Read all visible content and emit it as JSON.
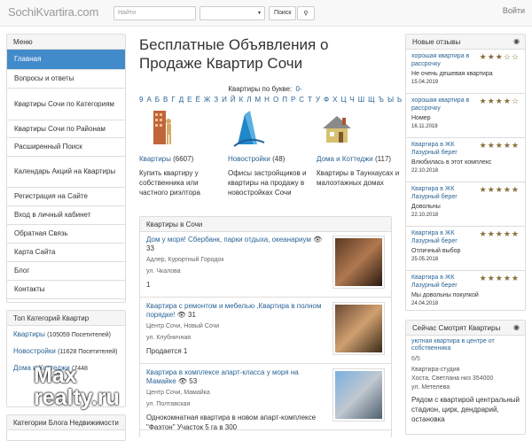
{
  "header": {
    "logo": "SochiKvartira",
    "logo_tld": ".com",
    "search_placeholder": "Найти",
    "search_button": "Поиск",
    "login": "Войти"
  },
  "menu": {
    "title": "Меню",
    "items": [
      "Главная",
      "Вопросы и ответы",
      "Квартиры Сочи по Категориям",
      "Квартиры Сочи по Районам",
      "Расширенный Поиск",
      "Календарь Акций на Квартиры",
      "Регистрация на Сайте",
      "Вход в личный кабинет",
      "Обратная Связь",
      "Карта Сайта",
      "Блог",
      "Контакты"
    ]
  },
  "top_categories": {
    "title": "Топ Категорий Квартир",
    "items": [
      {
        "name": "Квартиры",
        "count": "(105059 Посетителей)"
      },
      {
        "name": "Новостройки",
        "count": "(11628 Посетителей)"
      },
      {
        "name": "Дома и Коттеджи",
        "count": "(7448"
      }
    ]
  },
  "blog_categories": {
    "title": "Категории Блога Недвижимости"
  },
  "main": {
    "title": "Бесплатные Объявления о Продаже Квартир Сочи",
    "letters_label": "Квартиры по букве:",
    "letters": [
      "0-9",
      "А",
      "Б",
      "В",
      "Г",
      "Д",
      "Е",
      "Ё",
      "Ж",
      "З",
      "И",
      "Й",
      "К",
      "Л",
      "М",
      "Н",
      "О",
      "П",
      "Р",
      "С",
      "Т",
      "У",
      "Ф",
      "Х",
      "Ц",
      "Ч",
      "Ш",
      "Щ",
      "Ъ",
      "Ы",
      "Ь",
      "Э",
      "Ю",
      "Я"
    ],
    "cats": [
      {
        "name": "Квартиры",
        "count": "(6607)",
        "desc": "Купить квартиру у собственника или частного риэлтора"
      },
      {
        "name": "Новостройки",
        "count": "(48)",
        "desc": "Офисы застройщиков и квартиры на продажу в новостройках Сочи"
      },
      {
        "name": "Дома и Коттеджи",
        "count": "(117)",
        "desc": "Квартиры в Таунхаусах и малоэтажных домах"
      }
    ],
    "listings_title": "Квартиры в Сочи",
    "listings": [
      {
        "title": "Дом у моря! Сбербанк, парки отдыха, океанариум",
        "views": "33",
        "loc": "Адлер, Курортный Городок",
        "street": "ул. Чкалова",
        "text": "1"
      },
      {
        "title": "Квартира с ремонтом и мебелью ,Квартира в полном порядке!",
        "views": "31",
        "loc": "Центр Сочи, Новый Сочи",
        "street": "ул. Клубничная",
        "text": "Продается 1"
      },
      {
        "title": "Квартира в комплексе апарт-класса у моря на Мамайке",
        "views": "53",
        "loc": "Центр Сочи, Мамайка",
        "street": "ул. Полтавская",
        "text": "Однокомнатная квартира в новом апарт-комплексе \"Фаэтон\" Участок 5 га в 300"
      }
    ]
  },
  "reviews": {
    "title": "Новые отзывы",
    "items": [
      {
        "title": "хорошая квартира в рассрочку",
        "stars": 3,
        "comment": "Не очень дешевая квартира",
        "date": "15.04.2019"
      },
      {
        "title": "хорошая квартира в рассрочку",
        "stars": 4,
        "comment": "Номер",
        "date": "16.11.2018"
      },
      {
        "title": "Квартира в ЖК Лазурный берег",
        "stars": 5,
        "comment": "Влюбилась в этот комплекс",
        "date": "22.10.2018"
      },
      {
        "title": "Квартира в ЖК Лазурный берег",
        "stars": 5,
        "comment": "Довольны",
        "date": "22.10.2018"
      },
      {
        "title": "Квартира в ЖК Лазурный берег",
        "stars": 5,
        "comment": "Отличный выбор",
        "date": "25.05.2018"
      },
      {
        "title": "Квартира в ЖК Лазурный берег",
        "stars": 5,
        "comment": "Мы довольны покупкой",
        "date": "24.04.2018"
      }
    ]
  },
  "watching": {
    "title": "Сейчас Смотрят Квартиры",
    "item_title": "уютная квартира в центре от собственника",
    "rating": "6/5",
    "type": "Квартира-студия",
    "loc": "Хоста, Светлана низ 354000",
    "street": "ул. Метелева",
    "desc": "Рядом с квартирой центральный стадион, цирк, дендрарий, остановка"
  },
  "watermark": "Max\nrealty.ru",
  "colors": {
    "accent": "#428bca",
    "star": "#8a6d3b",
    "link": "#2a6496"
  }
}
